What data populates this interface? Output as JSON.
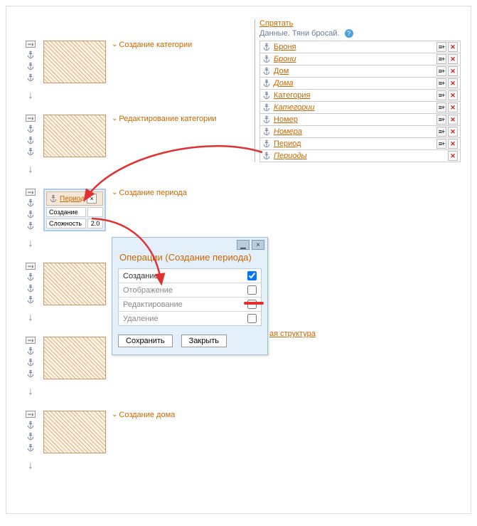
{
  "right": {
    "hide_link": "Спрятать",
    "header": "Данные. Тяни бросай.",
    "help_icon": "?",
    "items": [
      {
        "label": "Броня",
        "italic": false,
        "has_lines": true
      },
      {
        "label": "Брони",
        "italic": true,
        "has_lines": true
      },
      {
        "label": "Дом",
        "italic": false,
        "has_lines": true
      },
      {
        "label": "Дома",
        "italic": true,
        "has_lines": true
      },
      {
        "label": "Категория",
        "italic": false,
        "has_lines": true
      },
      {
        "label": "Категории",
        "italic": true,
        "has_lines": true
      },
      {
        "label": "Номер",
        "italic": false,
        "has_lines": true
      },
      {
        "label": "Номера",
        "italic": true,
        "has_lines": true
      },
      {
        "label": "Период",
        "italic": false,
        "has_lines": true
      },
      {
        "label": "Периоды",
        "italic": true,
        "has_lines": false
      }
    ],
    "bottom_link": "ая структура"
  },
  "nodes": [
    {
      "label": "Создание категории"
    },
    {
      "label": "Редактирование категории"
    },
    {
      "label": "Создание периода",
      "selected": true,
      "sel_link": "Период",
      "props": [
        {
          "k": "Создание",
          "v": ""
        },
        {
          "k": "Сложность",
          "v": "2.0"
        }
      ]
    },
    {
      "label": ""
    },
    {
      "label": ""
    },
    {
      "label": "Создание дома"
    }
  ],
  "dialog": {
    "title": "Операции (Создание периода)",
    "ops": [
      {
        "label": "Создание",
        "checked": true,
        "active": true
      },
      {
        "label": "Отображение",
        "checked": false,
        "active": false
      },
      {
        "label": "Редактирование",
        "checked": false,
        "active": false
      },
      {
        "label": "Удаление",
        "checked": false,
        "active": false
      }
    ],
    "save": "Сохранить",
    "close": "Закрыть"
  },
  "icons": {
    "minus": "−",
    "x": "×",
    "arrow_down": "↓",
    "chev": "⌄",
    "plus": "+"
  }
}
